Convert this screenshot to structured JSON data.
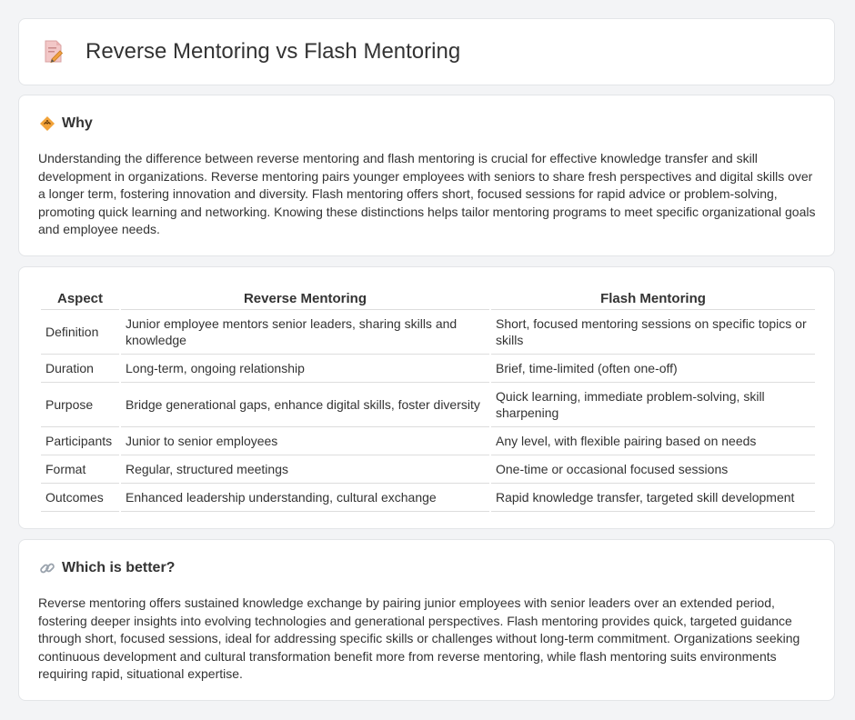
{
  "header": {
    "title": "Reverse Mentoring vs Flash Mentoring",
    "icon": "document-pencil-icon"
  },
  "why": {
    "icon": "diamond-sign-icon",
    "title": "Why",
    "body": "Understanding the difference between reverse mentoring and flash mentoring is crucial for effective knowledge transfer and skill development in organizations. Reverse mentoring pairs younger employees with seniors to share fresh perspectives and digital skills over a longer term, fostering innovation and diversity. Flash mentoring offers short, focused sessions for rapid advice or problem-solving, promoting quick learning and networking. Knowing these distinctions helps tailor mentoring programs to meet specific organizational goals and employee needs."
  },
  "comparison": {
    "headers": [
      "Aspect",
      "Reverse Mentoring",
      "Flash Mentoring"
    ],
    "rows": [
      [
        "Definition",
        "Junior employee mentors senior leaders, sharing skills and knowledge",
        "Short, focused mentoring sessions on specific topics or skills"
      ],
      [
        "Duration",
        "Long-term, ongoing relationship",
        "Brief, time-limited (often one-off)"
      ],
      [
        "Purpose",
        "Bridge generational gaps, enhance digital skills, foster diversity",
        "Quick learning, immediate problem-solving, skill sharpening"
      ],
      [
        "Participants",
        "Junior to senior employees",
        "Any level, with flexible pairing based on needs"
      ],
      [
        "Format",
        "Regular, structured meetings",
        "One-time or occasional focused sessions"
      ],
      [
        "Outcomes",
        "Enhanced leadership understanding, cultural exchange",
        "Rapid knowledge transfer, targeted skill development"
      ]
    ]
  },
  "better": {
    "icon": "link-icon",
    "title": "Which is better?",
    "body": "Reverse mentoring offers sustained knowledge exchange by pairing junior employees with senior leaders over an extended period, fostering deeper insights into evolving technologies and generational perspectives. Flash mentoring provides quick, targeted guidance through short, focused sessions, ideal for addressing specific skills or challenges without long-term commitment. Organizations seeking continuous development and cultural transformation benefit more from reverse mentoring, while flash mentoring suits environments requiring rapid, situational expertise."
  }
}
